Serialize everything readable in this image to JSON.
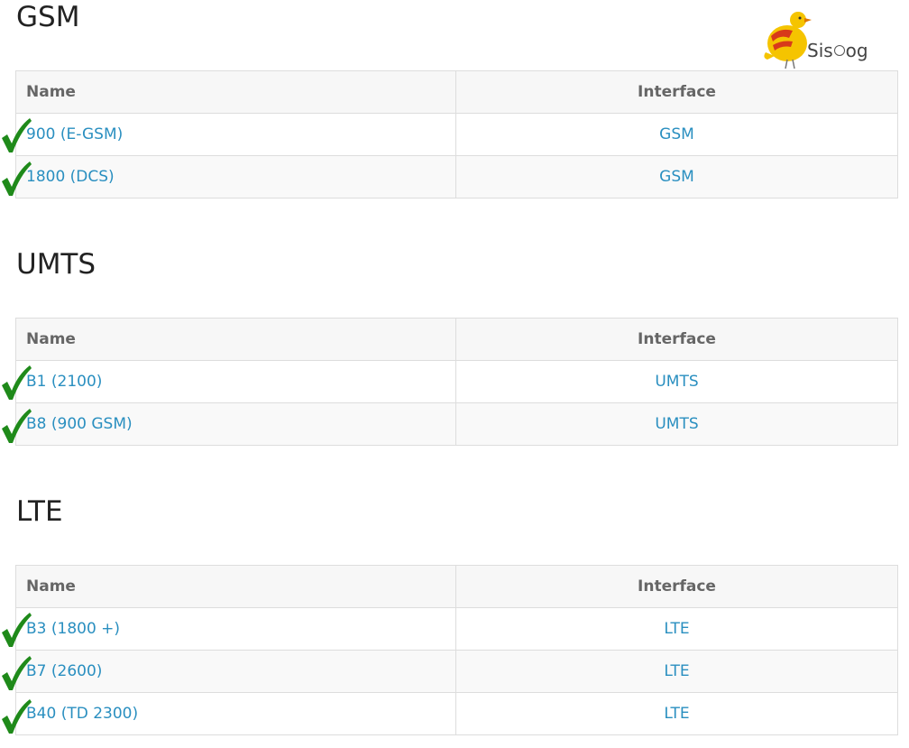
{
  "logo": {
    "text_pre": "Sis",
    "text_post": "og",
    "accent": "#f5c400"
  },
  "colors": {
    "link": "#2a8fc0",
    "check": "#1f8a1a",
    "header_bg": "#f7f7f7",
    "border": "#dddddd"
  },
  "icons": {
    "row_marker": "checkmark-icon"
  },
  "sections": [
    {
      "title": "GSM",
      "headers": {
        "name": "Name",
        "interface": "Interface"
      },
      "rows": [
        {
          "name": "900 (E-GSM)",
          "interface": "GSM",
          "checked": true
        },
        {
          "name": "1800 (DCS)",
          "interface": "GSM",
          "checked": true
        }
      ]
    },
    {
      "title": "UMTS",
      "headers": {
        "name": "Name",
        "interface": "Interface"
      },
      "rows": [
        {
          "name": "B1 (2100)",
          "interface": "UMTS",
          "checked": true
        },
        {
          "name": "B8 (900 GSM)",
          "interface": "UMTS",
          "checked": true
        }
      ]
    },
    {
      "title": "LTE",
      "headers": {
        "name": "Name",
        "interface": "Interface"
      },
      "rows": [
        {
          "name": "B3 (1800 +)",
          "interface": "LTE",
          "checked": true
        },
        {
          "name": "B7 (2600)",
          "interface": "LTE",
          "checked": true
        },
        {
          "name": "B40 (TD 2300)",
          "interface": "LTE",
          "checked": true
        }
      ]
    }
  ]
}
